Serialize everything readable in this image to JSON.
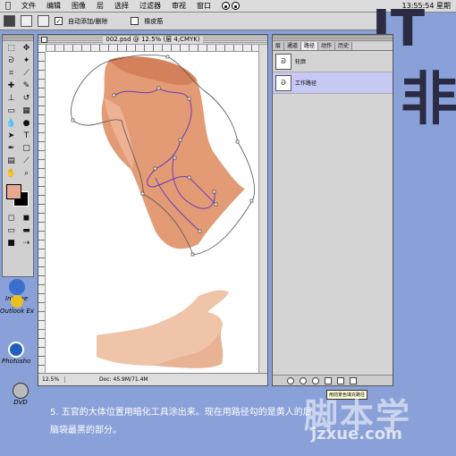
{
  "menubar": {
    "items": [
      "文件",
      "编辑",
      "图像",
      "层",
      "选择",
      "过滤器",
      "审视",
      "窗口"
    ],
    "clock": "13:55:54 星期"
  },
  "options": {
    "auto_add_label": "自动添加/删除",
    "rubber_band_label": "橡皮筋"
  },
  "document": {
    "title": "002.psd @ 12.5% (层 4,CMYK)",
    "zoom": "12.5%",
    "doc_info": "Doc: 45.9M/71.4M"
  },
  "palette": {
    "tabs": [
      "层",
      "通道",
      "路径",
      "动作",
      "历史"
    ],
    "active_tab": "路径",
    "paths": [
      {
        "name": "轮廓",
        "selected": false
      },
      {
        "name": "工作路径",
        "selected": true
      }
    ],
    "tooltip": "用前景色填充路径"
  },
  "desktop": {
    "big_chars": [
      "IT",
      "非"
    ],
    "icons": [
      {
        "label": "Interne",
        "icon": "internet-icon"
      },
      {
        "label": "Outlook Ex",
        "icon": "outlook-icon"
      },
      {
        "label": "Photosho",
        "icon": "photoshop-icon"
      },
      {
        "label": "DVD",
        "icon": "dvd-icon"
      }
    ]
  },
  "caption": {
    "line1": "5. 五官的大体位置用暗化工具涂出来。现在用路径勾的是黄人的后",
    "line2": "脑袋最黑的部分。"
  },
  "watermark": {
    "main": "脚本学",
    "url": "jzxue.com"
  },
  "colors": {
    "foreground": "#e8a892",
    "background": "#000000",
    "skin": "#e0926c",
    "path": "#6a3ab8"
  }
}
